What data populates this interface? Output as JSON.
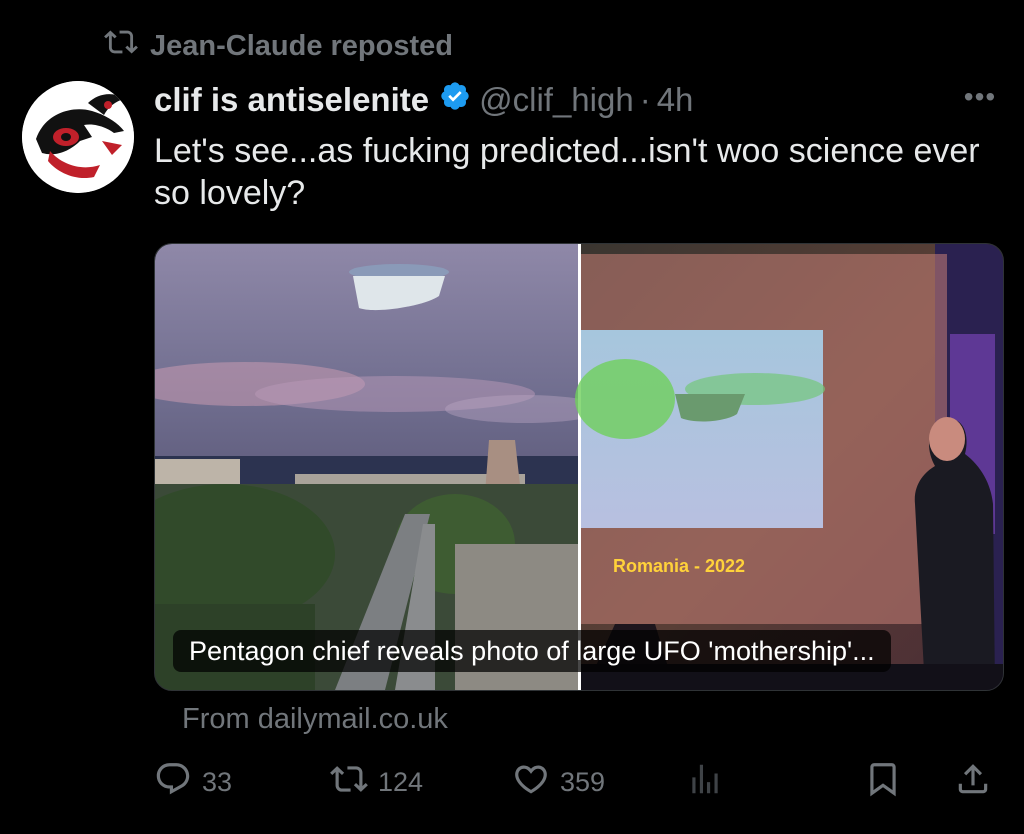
{
  "repost": {
    "label": "Jean-Claude reposted",
    "icon": "repost-icon"
  },
  "post": {
    "display_name": "clif is antiselenite",
    "verified_icon": "verified-badge-icon",
    "handle": "@clif_high",
    "separator": "·",
    "time": "4h",
    "more_icon": "more-options-icon",
    "text": "Let's see...as fucking predicted...isn't woo science ever so lovely?"
  },
  "media": {
    "caption": "Pentagon chief reveals photo of large UFO 'mothership'...",
    "slide_text": "Romania - 2022",
    "source": "From dailymail.co.uk"
  },
  "actions": {
    "replies": "33",
    "reposts": "124",
    "likes": "359"
  },
  "colors": {
    "background": "#000000",
    "text_primary": "#e7e9ea",
    "text_secondary": "#71767b",
    "verified": "#1d9bf0"
  }
}
